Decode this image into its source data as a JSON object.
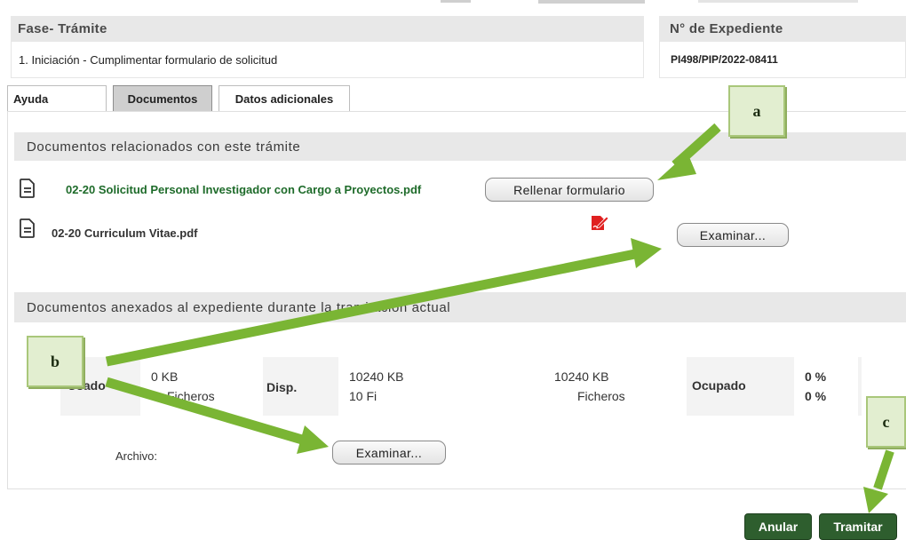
{
  "header": {
    "fase_label": "Fase- Trámite",
    "fase_value": "1. Iniciación -  Cumplimentar formulario de solicitud",
    "expediente_label": "N° de Expediente",
    "expediente_value": "PI498/PIP/2022-08411"
  },
  "tabs": [
    {
      "label": "Ayuda"
    },
    {
      "label": "Documentos"
    },
    {
      "label": "Datos adicionales"
    }
  ],
  "sections": {
    "related_title": "Documentos relacionados con este trámite",
    "attached_title": "Documentos anexados al expediente durante la tramitación actual"
  },
  "documents": [
    {
      "name": "02-20 Solicitud Personal Investigador con Cargo a Proyectos.pdf",
      "button": "Rellenar formulario"
    },
    {
      "name": "02-20 Curriculum Vitae.pdf",
      "button": "Examinar..."
    }
  ],
  "quota": {
    "usado_label": "Usado",
    "usado_kb": "0 KB",
    "usado_files": "Ficheros",
    "disp_label": "Disp.",
    "disp_kb": "10240 KB",
    "disp_files": "10 Fi",
    "max_kb": "10240 KB",
    "max_files": "Ficheros",
    "ocupado_label": "Ocupado",
    "ocupado_pct1": "0 %",
    "ocupado_pct2": "0 %"
  },
  "archivo": {
    "label": "Archivo:",
    "button": "Examinar..."
  },
  "actions": {
    "anular": "Anular",
    "tramitar": "Tramitar"
  },
  "callouts": {
    "a": "a",
    "b": "b",
    "c": "c"
  },
  "colors": {
    "link_green": "#1e6b2a",
    "arrow_green": "#7ab534",
    "button_green": "#2e5e2e",
    "pdf_icon_red": "#e02020"
  }
}
